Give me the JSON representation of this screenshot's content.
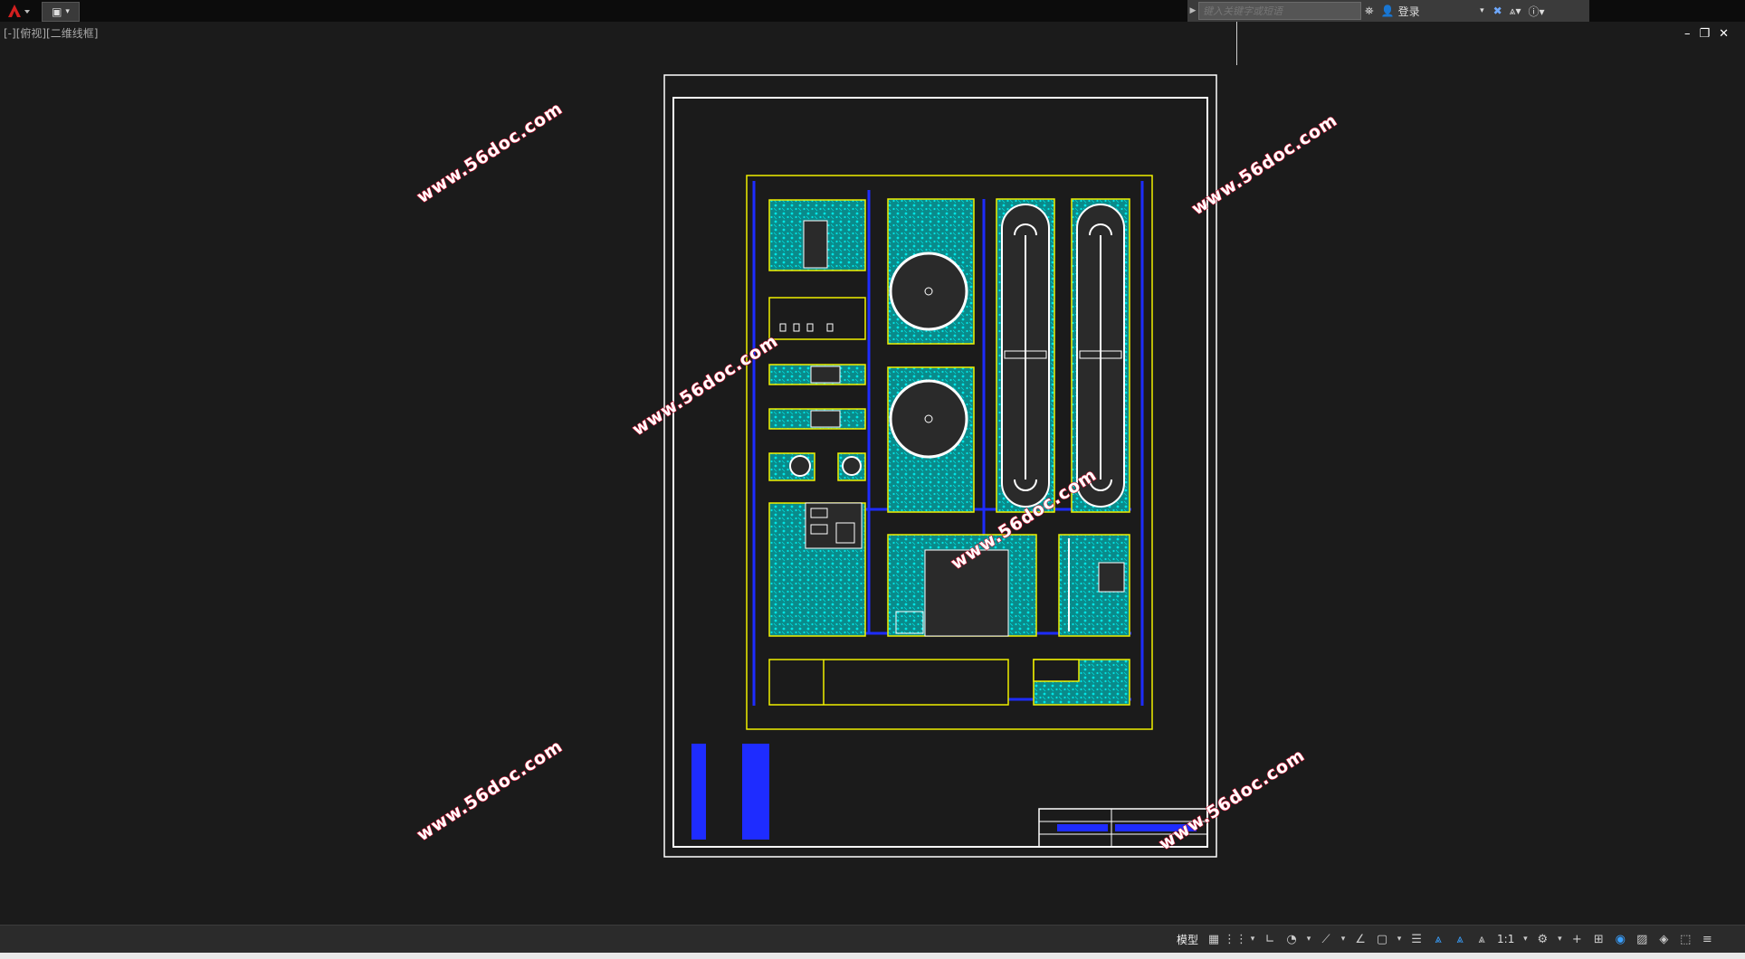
{
  "infocenter": {
    "search_placeholder": "键入关键字或短语",
    "signin_label": "登录"
  },
  "viewport": {
    "label": "[-][俯视][二维线框]"
  },
  "window_controls": {
    "minimize": "–",
    "restore": "❐",
    "close": "✕"
  },
  "watermarks": [
    "www.56doc.com",
    "www.56doc.com",
    "www.56doc.com",
    "www.56doc.com",
    "www.56doc.com",
    "www.56doc.com"
  ],
  "statusbar": {
    "model_label": "模型",
    "scale_label": "1:1"
  },
  "colors": {
    "background": "#1b1b1b",
    "border": "#ffffff",
    "plan_lines": "#f0f000",
    "hatch": "#00d0d0",
    "dims": "#0000ff",
    "watermark_stroke": "#c8102e"
  }
}
